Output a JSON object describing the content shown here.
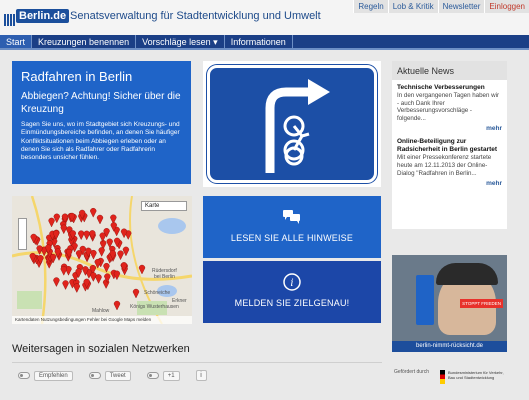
{
  "header": {
    "logo_text": "Berlin.de",
    "site_title": "Senatsverwaltung für Stadtentwicklung und Umwelt",
    "top_links": [
      "Regeln",
      "Lob & Kritik",
      "Newsletter",
      "Einloggen"
    ]
  },
  "nav": {
    "items": [
      "Start",
      "Kreuzungen benennen",
      "Vorschläge lesen ▾",
      "Informationen"
    ]
  },
  "intro": {
    "title": "Radfahren in Berlin",
    "subtitle": "Abbiegen? Achtung! Sicher über die Kreuzung",
    "text": "Sagen Sie uns, wo im Stadtgebiet sich Kreuzungs- und Einmündungsbereiche befinden, an denen Sie häufiger Konfliktsituationen beim Abbiegen erleben oder an denen Sie sich als Radfahrer oder Radfahrerin besonders unsicher fühlen."
  },
  "map": {
    "select_label": "Karte",
    "place_labels": [
      "Rüdersdorf",
      "bei Berlin",
      "Schöneiche",
      "Erkner",
      "Königs Wusterhausen",
      "Mahlow"
    ],
    "footer_text": "Kartendaten   Nutzungsbedingungen   Fehler bei Google Maps melden"
  },
  "actions": {
    "hints_label": "LESEN SIE ALLE HINWEISE",
    "report_label": "MELDEN SIE ZIELGENAU!"
  },
  "news": {
    "heading": "Aktuelle News",
    "items": [
      {
        "title": "Technische Verbesserungen",
        "text": "In den vergangenen Tagen haben wir - auch Dank Ihrer Verbesserungsvorschläge - folgende...",
        "more": "mehr"
      },
      {
        "title": "Online-Beteiligung zur Radsicherheit in Berlin gestartet",
        "text": "Mit einer Pressekonferenz startete heute am 12.11.2013 der Online-Dialog \"Radfahren in Berlin...",
        "more": "mehr"
      }
    ]
  },
  "promo": {
    "badge": "STOPPT FRIEDEN",
    "url": "berlin-nimmt-rücksicht.de"
  },
  "social": {
    "heading": "Weitersagen in sozialen Netzwerken",
    "buttons": [
      "Empfehlen",
      "Tweet",
      "+1"
    ],
    "info": "i"
  },
  "footer": {
    "label": "Gefördert durch",
    "ministry": "Bundesministerium für Verkehr, Bau und Stadtentwicklung"
  },
  "colors": {
    "nav_bg": "#1b3f86",
    "panel_blue": "#1f64c8",
    "marker_red": "#e0231c"
  }
}
